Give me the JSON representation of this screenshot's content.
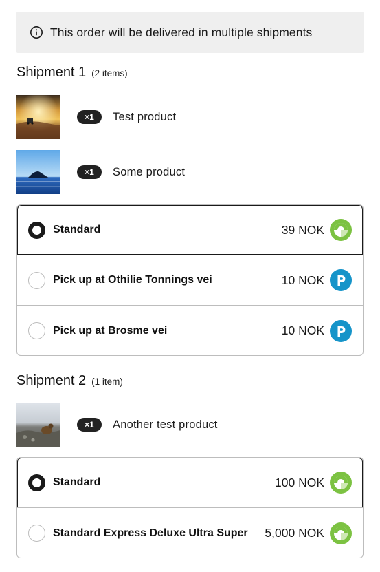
{
  "notice": {
    "text": "This order will be delivered in multiple shipments",
    "icon": "info-icon"
  },
  "colors": {
    "brand_green": "#7cc242",
    "brand_blue": "#1694c9",
    "dark": "#1a1a1a"
  },
  "shipments": [
    {
      "title": "Shipment 1",
      "count": "(2 items)",
      "items": [
        {
          "qty": "×1",
          "name": "Test product"
        },
        {
          "qty": "×1",
          "name": "Some product"
        }
      ],
      "options": [
        {
          "label": "Standard",
          "price": "39 NOK",
          "selected": true,
          "carrier_icon": "carrier-green-icon"
        },
        {
          "label": "Pick up at Othilie Tonnings vei",
          "price": "10 NOK",
          "selected": false,
          "carrier_icon": "carrier-blue-p-icon"
        },
        {
          "label": "Pick up at Brosme vei",
          "price": "10 NOK",
          "selected": false,
          "carrier_icon": "carrier-blue-p-icon"
        }
      ]
    },
    {
      "title": "Shipment 2",
      "count": "(1 item)",
      "items": [
        {
          "qty": "×1",
          "name": "Another test product"
        }
      ],
      "options": [
        {
          "label": "Standard",
          "price": "100 NOK",
          "selected": true,
          "carrier_icon": "carrier-green-icon"
        },
        {
          "label": "Standard Express Deluxe Ultra Super",
          "price": "5,000 NOK",
          "selected": false,
          "carrier_icon": "carrier-green-icon"
        }
      ]
    }
  ]
}
